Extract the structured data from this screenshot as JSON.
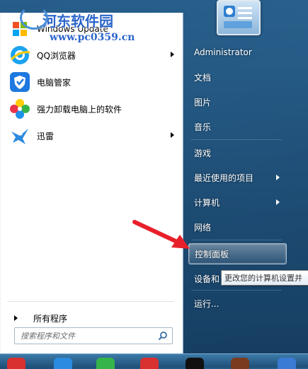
{
  "left_pane": {
    "items": [
      {
        "label": "Windows Update",
        "icon": "windows-update-icon",
        "has_submenu": false
      },
      {
        "label": "QQ浏览器",
        "icon": "qq-browser-icon",
        "has_submenu": true
      },
      {
        "label": "电脑管家",
        "icon": "pc-manager-shield-icon",
        "has_submenu": false
      },
      {
        "label": "强力卸载电脑上的软件",
        "icon": "uninstaller-flower-icon",
        "has_submenu": false
      },
      {
        "label": "迅雷",
        "icon": "xunlei-bird-icon",
        "has_submenu": true
      }
    ],
    "all_programs": "所有程序",
    "search_placeholder": "搜索程序和文件"
  },
  "right_pane": {
    "items": [
      {
        "label": "Administrator",
        "has_submenu": false
      },
      {
        "label": "文档",
        "has_submenu": false
      },
      {
        "label": "图片",
        "has_submenu": false
      },
      {
        "label": "音乐",
        "has_submenu": false
      },
      {
        "label": "游戏",
        "has_submenu": false
      },
      {
        "label": "最近使用的项目",
        "has_submenu": true
      },
      {
        "label": "计算机",
        "has_submenu": true
      },
      {
        "label": "网络",
        "has_submenu": false
      },
      {
        "label": "控制面板",
        "has_submenu": false,
        "highlighted": true
      },
      {
        "label": "设备和",
        "has_submenu": false
      },
      {
        "label": "运行...",
        "has_submenu": false
      }
    ]
  },
  "tooltip": "更改您的计算机设置并",
  "watermark": {
    "line1": "河东软件园",
    "line2": "www.pc0359.cn"
  },
  "colors": {
    "menu_blue": "#1d4f78",
    "highlight_border": "#ffffff",
    "annotation_arrow": "#e8202a"
  }
}
